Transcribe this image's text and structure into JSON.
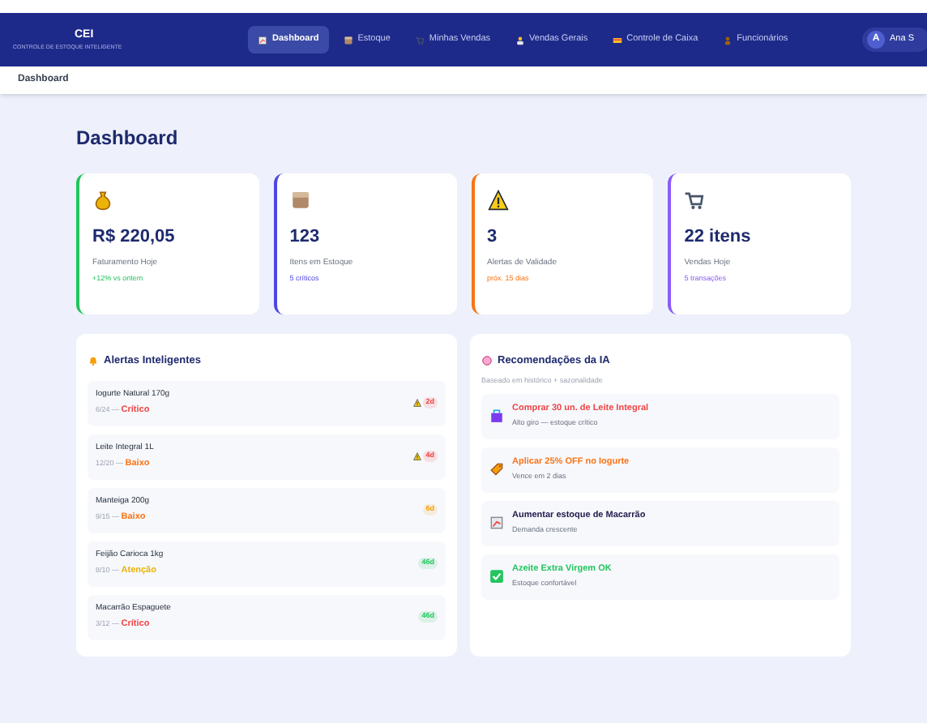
{
  "brand": {
    "logo": "CEI",
    "subtitle": "CONTROLE DE ESTOQUE INTELIGENTE"
  },
  "nav": [
    {
      "label": "Dashboard",
      "kind": "chart",
      "selected": true
    },
    {
      "label": "Estoque",
      "kind": "box",
      "selected": false
    },
    {
      "label": "Minhas Vendas",
      "kind": "cart",
      "selected": false
    },
    {
      "label": "Vendas Gerais",
      "kind": "people",
      "selected": false
    },
    {
      "label": "Controle de Caixa",
      "kind": "cash",
      "selected": false
    },
    {
      "label": "Funcionários",
      "kind": "person",
      "selected": false
    }
  ],
  "user": {
    "initial": "A",
    "name": "Ana S"
  },
  "breadcrumb": "Dashboard",
  "page_title": "Dashboard",
  "stats": [
    {
      "kind": "money",
      "value": "R$ 220,05",
      "label": "Faturamento Hoje",
      "note": "+12% vs ontem",
      "color": "#22c55e"
    },
    {
      "kind": "box",
      "value": "123",
      "label": "Itens em Estoque",
      "note": "5 críticos",
      "color": "#4f46e5"
    },
    {
      "kind": "warning",
      "value": "3",
      "label": "Alertas de Validade",
      "note": "próx. 15 dias",
      "color": "#f97316"
    },
    {
      "kind": "cart",
      "value": "22 itens",
      "label": "Vendas Hoje",
      "note": "5 transações",
      "color": "#8b5cf6"
    }
  ],
  "alerts": {
    "title": "Alertas Inteligentes",
    "items": [
      {
        "name": "Iogurte Natural 170g",
        "date": "6/24 —",
        "status": {
          "label": "Crítico",
          "color": "#ef4444"
        },
        "badge": {
          "label": "2d",
          "color": "#ef4444"
        },
        "warning": true
      },
      {
        "name": "Leite Integral 1L",
        "date": "12/20 —",
        "status": {
          "label": "Baixo",
          "color": "#f97316"
        },
        "badge": {
          "label": "4d",
          "color": "#ef4444"
        },
        "warning": true
      },
      {
        "name": "Manteiga 200g",
        "date": "9/15 —",
        "status": {
          "label": "Baixo",
          "color": "#f97316"
        },
        "badge": {
          "label": "6d",
          "color": "#f59e0b"
        },
        "warning": false
      },
      {
        "name": "Feijão Carioca 1kg",
        "date": "8/10 —",
        "status": {
          "label": "Atenção",
          "color": "#eab308"
        },
        "badge": {
          "label": "46d",
          "color": "#22c55e"
        },
        "warning": false
      },
      {
        "name": "Macarrão Espaguete",
        "date": "3/12 —",
        "status": {
          "label": "Crítico",
          "color": "#ef4444"
        },
        "badge": {
          "label": "46d",
          "color": "#22c55e"
        },
        "warning": false
      }
    ]
  },
  "recommendations": {
    "title": "Recomendações da IA",
    "subtitle": "Baseado em histórico + sazonalidade",
    "items": [
      {
        "kind": "bag",
        "title": "Comprar 30 un. de Leite Integral",
        "detail": "Alto giro — estoque crítico",
        "color": "#ef4444"
      },
      {
        "kind": "tag",
        "title": "Aplicar 25% OFF no Iogurte",
        "detail": "Vence em 2 dias",
        "color": "#f97316"
      },
      {
        "kind": "chart",
        "title": "Aumentar estoque de Macarrão",
        "detail": "Demanda crescente",
        "color": "#1e1b4b"
      },
      {
        "kind": "check",
        "title": "Azeite Extra Virgem OK",
        "detail": "Estoque confortável",
        "color": "#22c55e"
      }
    ]
  }
}
